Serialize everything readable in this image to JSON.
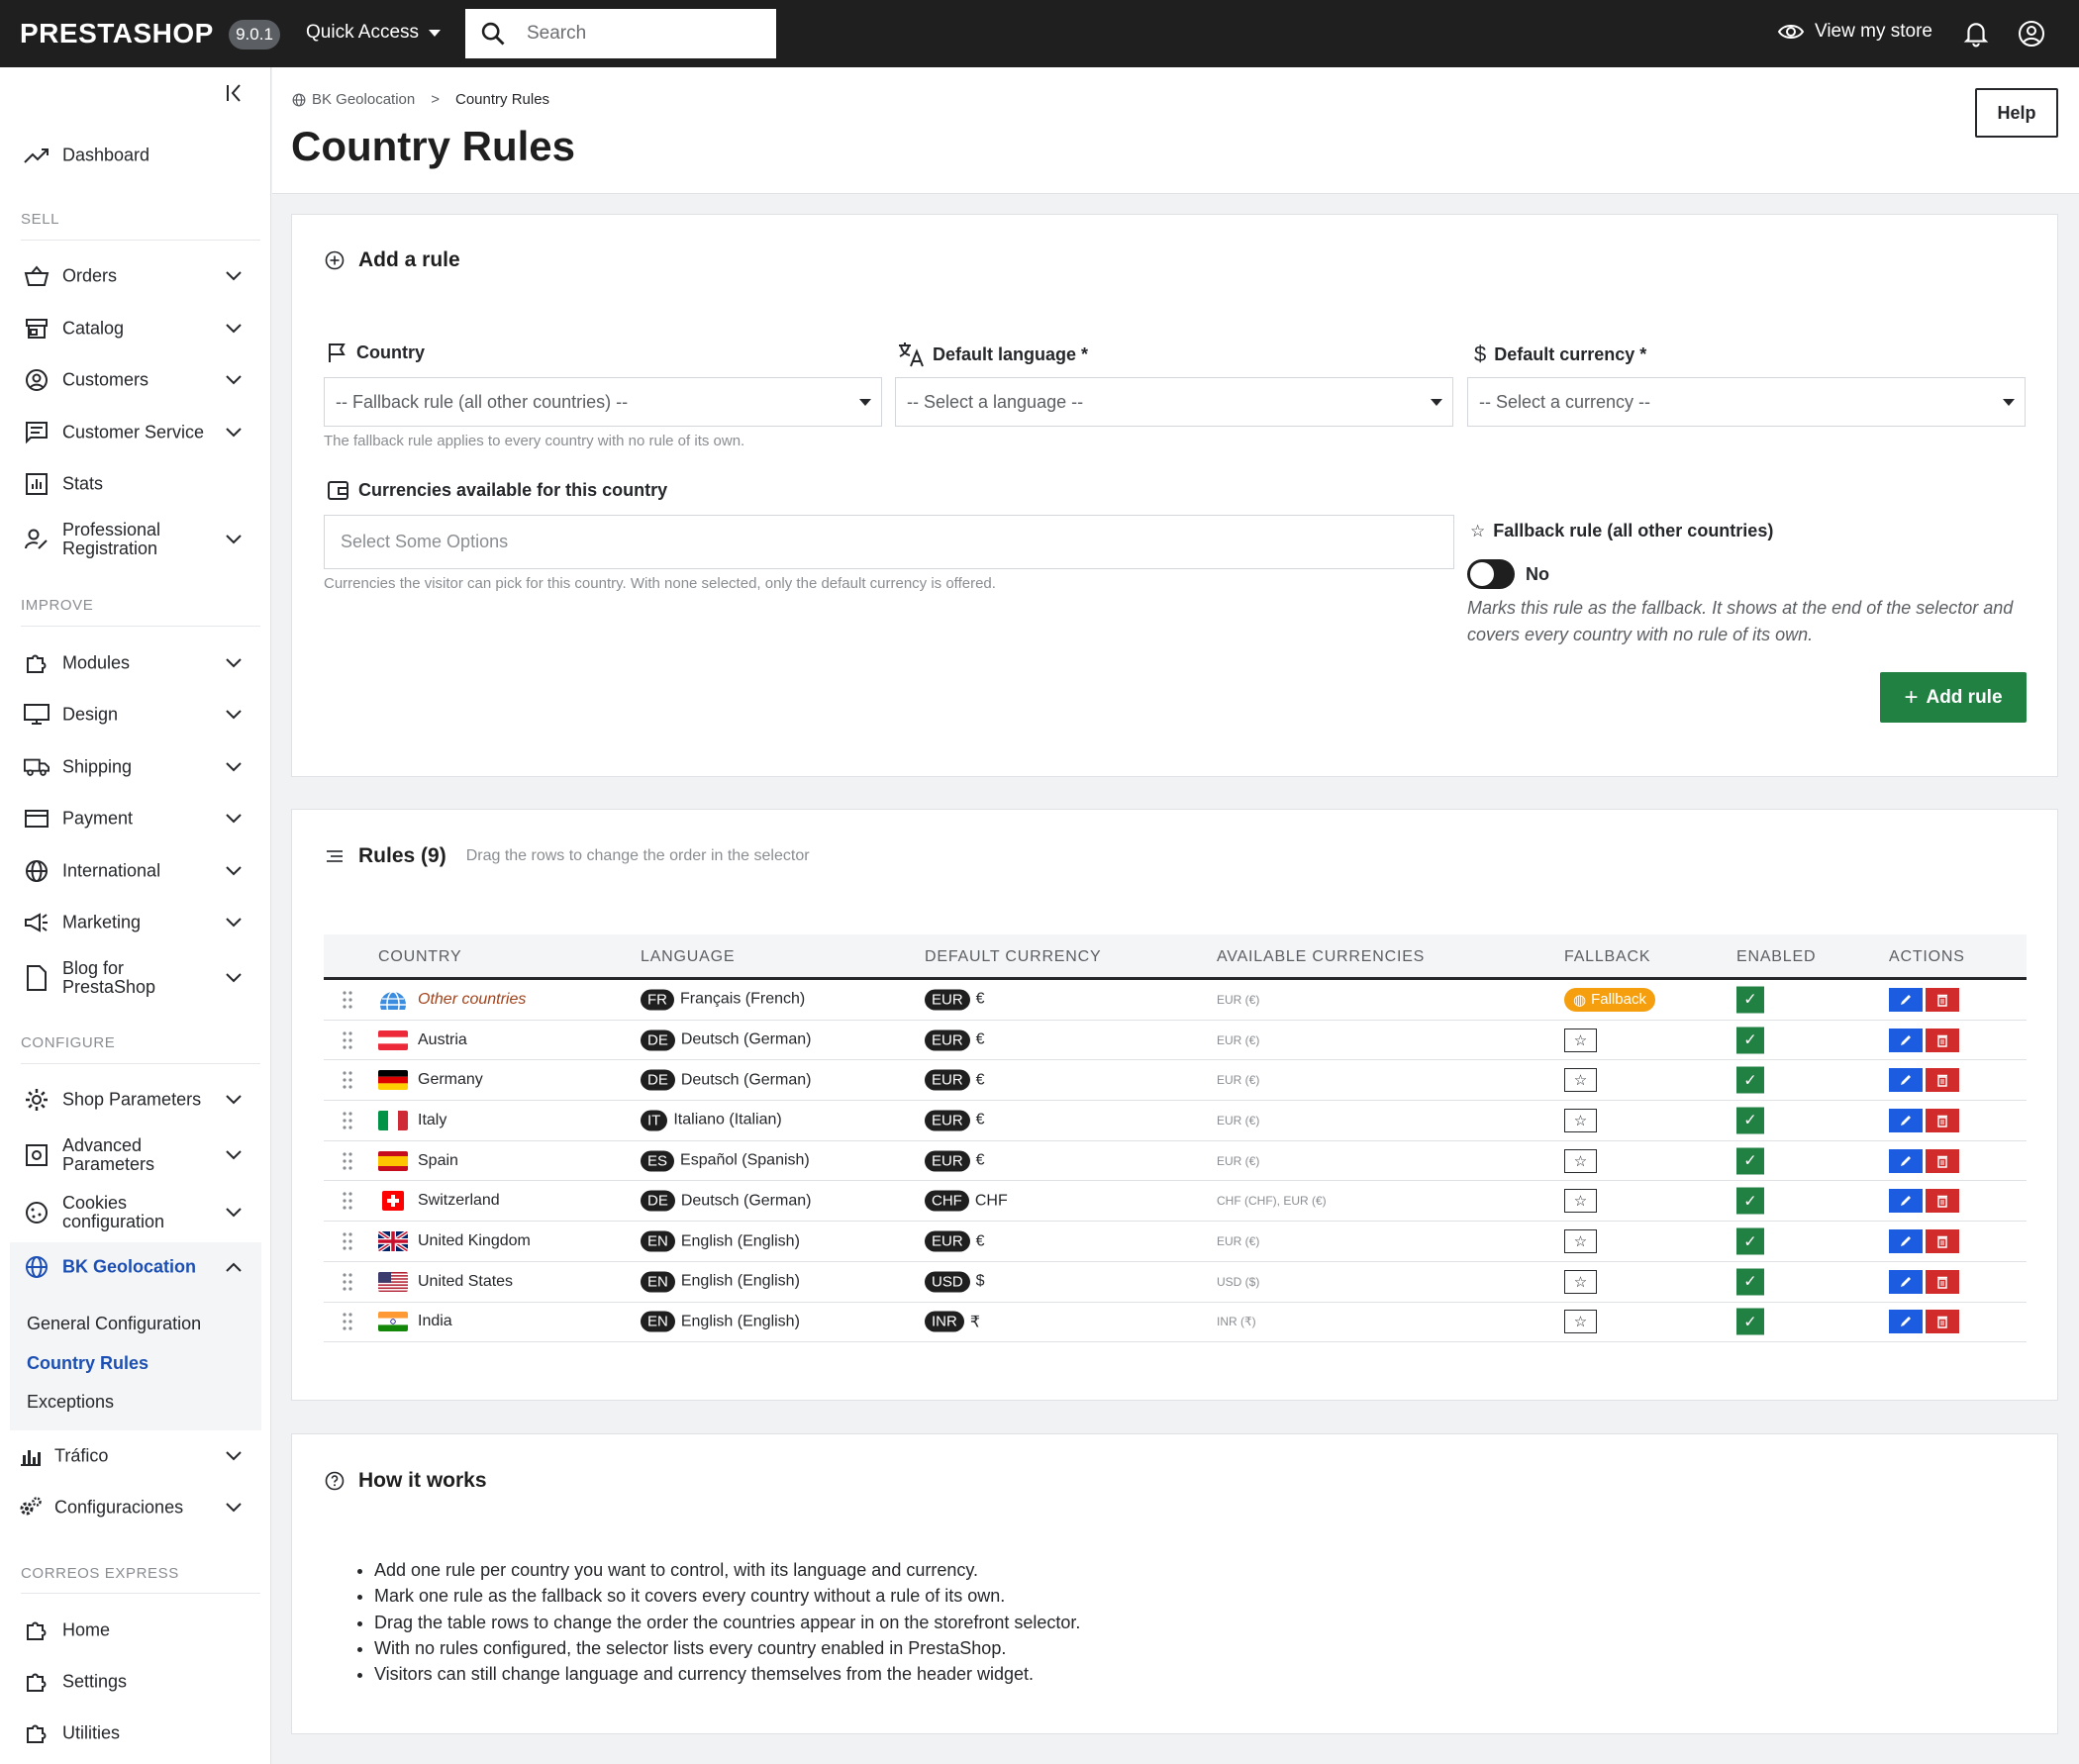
{
  "topbar": {
    "logo": "PRESTASHOP",
    "version": "9.0.1",
    "quick_access": "Quick Access",
    "search_placeholder": "Search",
    "view_store": "View my store"
  },
  "sidebar": {
    "dashboard": "Dashboard",
    "sections": {
      "sell": "SELL",
      "improve": "IMPROVE",
      "configure": "CONFIGURE",
      "correos": "CORREOS EXPRESS"
    },
    "sell_items": [
      "Orders",
      "Catalog",
      "Customers",
      "Customer Service",
      "Stats"
    ],
    "professional_1": "Professional",
    "professional_2": "Registration",
    "improve_items": [
      "Modules",
      "Design",
      "Shipping",
      "Payment",
      "International",
      "Marketing"
    ],
    "blog_1": "Blog for",
    "blog_2": "PrestaShop",
    "shop_parameters": "Shop Parameters",
    "advanced_1": "Advanced",
    "advanced_2": "Parameters",
    "cookies_1": "Cookies",
    "cookies_2": "configuration",
    "bk_geolocation": "BK Geolocation",
    "bk_sub": [
      "General Configuration",
      "Country Rules",
      "Exceptions"
    ],
    "trafico": "Tráfico",
    "configuraciones": "Configuraciones",
    "correos_items": [
      "Home",
      "Settings",
      "Utilities"
    ]
  },
  "header": {
    "crumb_parent": "BK Geolocation",
    "crumb_sep": ">",
    "crumb_current": "Country Rules",
    "title": "Country Rules",
    "help": "Help"
  },
  "add_rule": {
    "title": "Add a rule",
    "country_label": "Country",
    "country_value": "-- Fallback rule (all other countries) --",
    "country_hint": "The fallback rule applies to every country with no rule of its own.",
    "language_label": "Default language *",
    "language_value": "-- Select a language --",
    "currency_label": "Default currency *",
    "currency_value": "-- Select a currency --",
    "avail_label": "Currencies available for this country",
    "avail_placeholder": "Select Some Options",
    "avail_hint": "Currencies the visitor can pick for this country. With none selected, only the default currency is offered.",
    "fallback_label": "Fallback rule (all other countries)",
    "fallback_toggle": "No",
    "fallback_desc": "Marks this rule as the fallback. It shows at the end of the selector and covers every country with no rule of its own.",
    "submit": "Add rule"
  },
  "rules": {
    "title": "Rules (9)",
    "subtitle": "Drag the rows to change the order in the selector",
    "columns": [
      "COUNTRY",
      "LANGUAGE",
      "DEFAULT CURRENCY",
      "AVAILABLE CURRENCIES",
      "FALLBACK",
      "ENABLED",
      "ACTIONS"
    ],
    "fallback_badge": "Fallback",
    "rows": [
      {
        "country": "Other countries",
        "flag": "globe",
        "lang_code": "FR",
        "lang": "Français (French)",
        "cur_code": "EUR",
        "cur_sym": "€",
        "avail": "EUR (€)",
        "fallback": true,
        "enabled": true
      },
      {
        "country": "Austria",
        "flag": "at",
        "lang_code": "DE",
        "lang": "Deutsch (German)",
        "cur_code": "EUR",
        "cur_sym": "€",
        "avail": "EUR (€)",
        "fallback": false,
        "enabled": true
      },
      {
        "country": "Germany",
        "flag": "de",
        "lang_code": "DE",
        "lang": "Deutsch (German)",
        "cur_code": "EUR",
        "cur_sym": "€",
        "avail": "EUR (€)",
        "fallback": false,
        "enabled": true
      },
      {
        "country": "Italy",
        "flag": "it",
        "lang_code": "IT",
        "lang": "Italiano (Italian)",
        "cur_code": "EUR",
        "cur_sym": "€",
        "avail": "EUR (€)",
        "fallback": false,
        "enabled": true
      },
      {
        "country": "Spain",
        "flag": "es",
        "lang_code": "ES",
        "lang": "Español (Spanish)",
        "cur_code": "EUR",
        "cur_sym": "€",
        "avail": "EUR (€)",
        "fallback": false,
        "enabled": true
      },
      {
        "country": "Switzerland",
        "flag": "ch",
        "lang_code": "DE",
        "lang": "Deutsch (German)",
        "cur_code": "CHF",
        "cur_sym": "CHF",
        "avail": "CHF (CHF), EUR (€)",
        "fallback": false,
        "enabled": true
      },
      {
        "country": "United Kingdom",
        "flag": "gb",
        "lang_code": "EN",
        "lang": "English (English)",
        "cur_code": "EUR",
        "cur_sym": "€",
        "avail": "EUR (€)",
        "fallback": false,
        "enabled": true
      },
      {
        "country": "United States",
        "flag": "us",
        "lang_code": "EN",
        "lang": "English (English)",
        "cur_code": "USD",
        "cur_sym": "$",
        "avail": "USD ($)",
        "fallback": false,
        "enabled": true
      },
      {
        "country": "India",
        "flag": "in",
        "lang_code": "EN",
        "lang": "English (English)",
        "cur_code": "INR",
        "cur_sym": "₹",
        "avail": "INR (₹)",
        "fallback": false,
        "enabled": true
      }
    ]
  },
  "how": {
    "title": "How it works",
    "items": [
      "Add one rule per country you want to control, with its language and currency.",
      "Mark one rule as the fallback so it covers every country without a rule of its own.",
      "Drag the table rows to change the order the countries appear in on the storefront selector.",
      "With no rules configured, the selector lists every country enabled in PrestaShop.",
      "Visitors can still change language and currency themselves from the header widget."
    ]
  },
  "colors": {
    "topbar": "#1f1f1f",
    "primary_green": "#218143",
    "link_blue": "#1c4fb4",
    "fallback_orange": "#f59f0e",
    "edit_blue": "#1c5ce0",
    "delete_red": "#d22b2b"
  }
}
